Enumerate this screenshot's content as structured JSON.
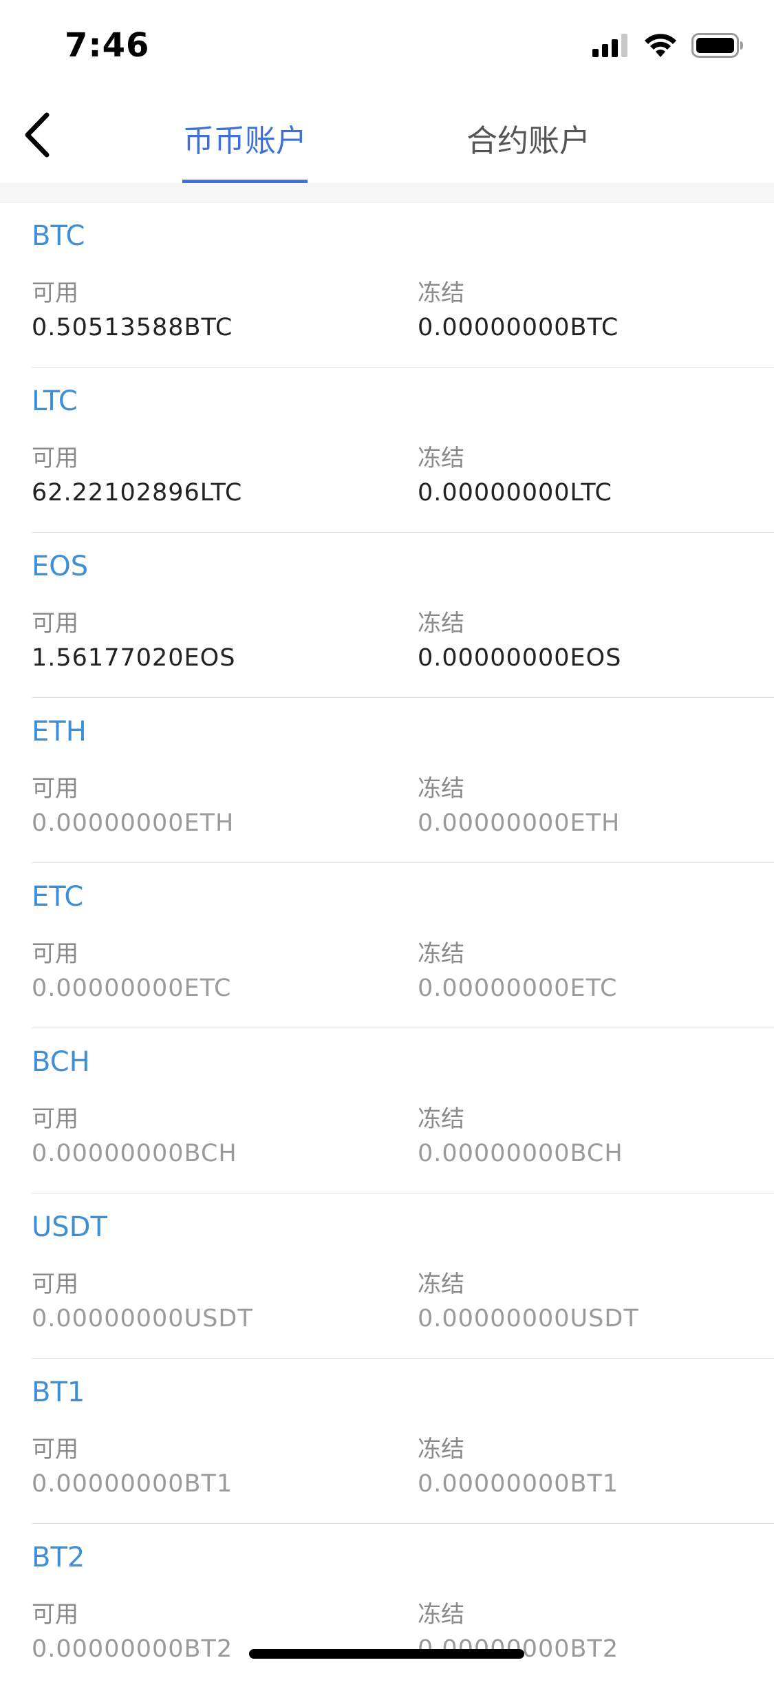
{
  "status_bar": {
    "time": "7:46"
  },
  "nav": {
    "tabs": [
      {
        "label": "币币账户",
        "active": true
      },
      {
        "label": "合约账户",
        "active": false
      }
    ]
  },
  "assets": {
    "available_label": "可用",
    "frozen_label": "冻结",
    "items": [
      {
        "coin": "BTC",
        "available": "0.50513588BTC",
        "frozen": "0.00000000BTC"
      },
      {
        "coin": "LTC",
        "available": "62.22102896LTC",
        "frozen": "0.00000000LTC"
      },
      {
        "coin": "EOS",
        "available": "1.56177020EOS",
        "frozen": "0.00000000EOS"
      },
      {
        "coin": "ETH",
        "available": "0.00000000ETH",
        "frozen": "0.00000000ETH"
      },
      {
        "coin": "ETC",
        "available": "0.00000000ETC",
        "frozen": "0.00000000ETC"
      },
      {
        "coin": "BCH",
        "available": "0.00000000BCH",
        "frozen": "0.00000000BCH"
      },
      {
        "coin": "USDT",
        "available": "0.00000000USDT",
        "frozen": "0.00000000USDT"
      },
      {
        "coin": "BT1",
        "available": "0.00000000BT1",
        "frozen": "0.00000000BT1"
      },
      {
        "coin": "BT2",
        "available": "0.00000000BT2",
        "frozen": "0.00000000BT2"
      }
    ]
  },
  "colors": {
    "accent": "#3e70d8",
    "coin_name": "#3d8fd6",
    "value_nonzero": "#222222",
    "value_zero": "#9a9a9a"
  }
}
